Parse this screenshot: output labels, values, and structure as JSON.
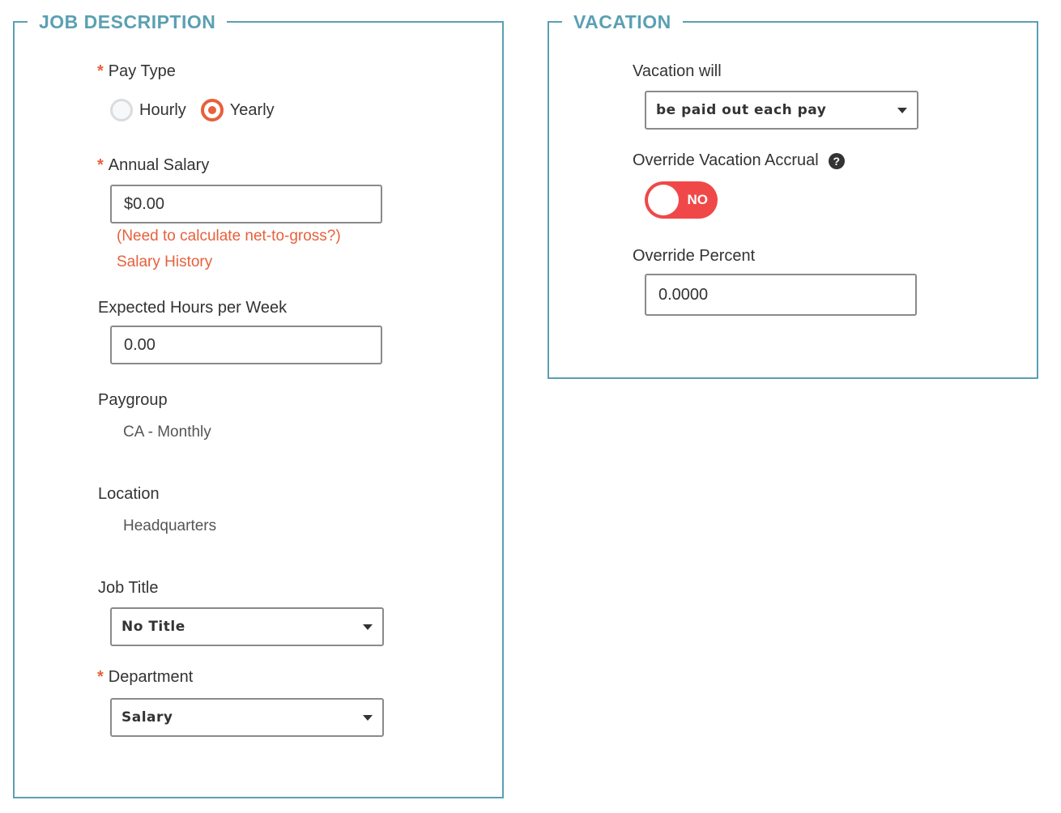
{
  "job": {
    "title": "JOB DESCRIPTION",
    "pay_type": {
      "label": "Pay Type",
      "required_mark": "*",
      "options": [
        "Hourly",
        "Yearly"
      ],
      "selected": "Yearly"
    },
    "annual_salary": {
      "label": "Annual Salary",
      "required_mark": "*",
      "value": "$0.00",
      "links": [
        "(Need to calculate net-to-gross?)",
        "Salary History"
      ]
    },
    "hours": {
      "label": "Expected Hours per Week",
      "value": "0.00"
    },
    "paygroup": {
      "label": "Paygroup",
      "value": "CA - Monthly"
    },
    "location": {
      "label": "Location",
      "value": "Headquarters"
    },
    "job_title": {
      "label": "Job Title",
      "selected": "No Title"
    },
    "department": {
      "label": "Department",
      "required_mark": "*",
      "selected": "Salary"
    }
  },
  "vacation": {
    "title": "VACATION",
    "vacation_will": {
      "label": "Vacation will",
      "selected": "be paid out each pay"
    },
    "override_accrual": {
      "label": "Override Vacation Accrual",
      "help_icon": "question-circle-icon",
      "help_glyph": "?",
      "toggle_text": "NO",
      "toggle_on": false
    },
    "override_percent": {
      "label": "Override Percent",
      "value": "0.0000"
    }
  },
  "colors": {
    "accent_teal": "#5aa0b3",
    "accent_orange": "#e8603c",
    "toggle_red": "#f04848"
  }
}
